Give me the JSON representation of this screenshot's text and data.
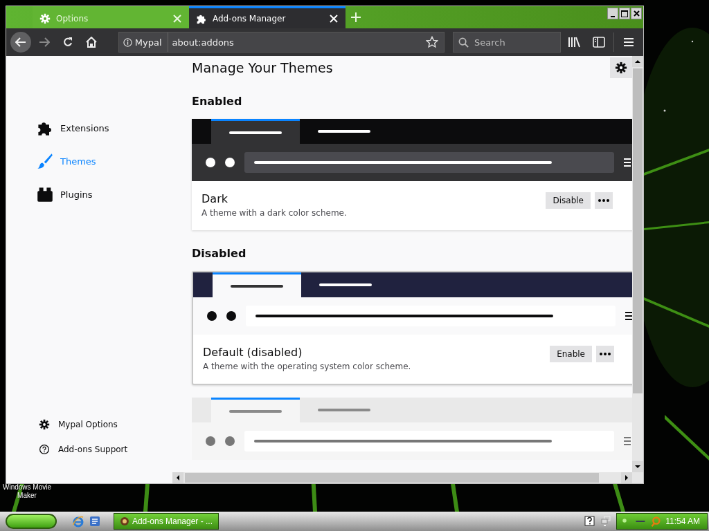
{
  "window": {
    "tabs": [
      {
        "label": "Options",
        "selected": false,
        "kind": "gear"
      },
      {
        "label": "Add-ons Manager",
        "selected": true,
        "kind": "puzzle"
      }
    ]
  },
  "toolbar": {
    "identity": "Mypal",
    "url": "about:addons",
    "search": {
      "placeholder": "Search"
    }
  },
  "sidebar": {
    "items": [
      {
        "label": "Extensions",
        "selected": false,
        "kind": "puzzle"
      },
      {
        "label": "Themes",
        "selected": true,
        "kind": "brush"
      },
      {
        "label": "Plugins",
        "selected": false,
        "kind": "plugin"
      }
    ],
    "footer": [
      {
        "label": "Mypal Options",
        "kind": "gear"
      },
      {
        "label": "Add-ons Support",
        "kind": "help"
      }
    ]
  },
  "main": {
    "title": "Manage Your Themes",
    "sections": [
      {
        "heading": "Enabled",
        "themes": [
          {
            "kind": "dark",
            "focused": false,
            "name": "Dark",
            "description": "A theme with a dark color scheme.",
            "button": "Disable"
          }
        ]
      },
      {
        "heading": "Disabled",
        "themes": [
          {
            "kind": "light",
            "focused": true,
            "name": "Default (disabled)",
            "description": "A theme with the operating system color scheme.",
            "button": "Enable"
          },
          {
            "kind": "faded",
            "focused": false
          }
        ]
      }
    ]
  },
  "desktop": {
    "icon_label": [
      "Windows Movie",
      "Maker"
    ]
  },
  "taskbar": {
    "task": "Add-ons Manager - ...",
    "clock": "11:54 AM"
  }
}
